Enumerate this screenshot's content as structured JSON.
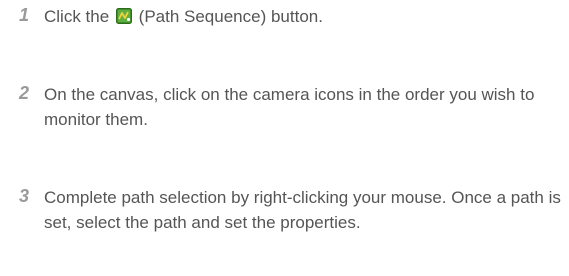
{
  "steps": [
    {
      "number": "1",
      "text_before_icon": "Click the",
      "icon": "path-sequence-icon",
      "text_after_icon": "(Path Sequence) button."
    },
    {
      "number": "2",
      "text": "On the canvas, click on the camera icons in the order you wish to monitor them."
    },
    {
      "number": "3",
      "text": "Complete path selection by right-clicking your mouse. Once a path is set, select the path and set the properties."
    }
  ],
  "colors": {
    "step_number": "#9a9a9a",
    "body_text": "#555555",
    "icon_green": "#3f8f2a",
    "icon_yellow": "#f0d23a"
  }
}
